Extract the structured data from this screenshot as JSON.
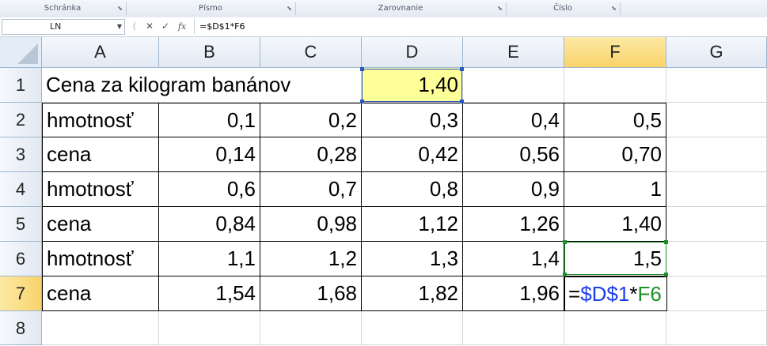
{
  "ribbon": {
    "groups": [
      {
        "label": "Schránka"
      },
      {
        "label": "Písmo"
      },
      {
        "label": "Zarovnanie"
      },
      {
        "label": "Číslo"
      }
    ]
  },
  "formula_bar": {
    "name_box": "LN",
    "cancel_glyph": "✕",
    "enter_glyph": "✓",
    "fx_label": "fx",
    "formula": "=$D$1*F6"
  },
  "columns": [
    "A",
    "B",
    "C",
    "D",
    "E",
    "F",
    "G"
  ],
  "rows": [
    "1",
    "2",
    "3",
    "4",
    "5",
    "6",
    "7",
    "8"
  ],
  "active_column": "F",
  "active_row": "7",
  "cells": {
    "A1": "Cena za kilogram banánov",
    "D1": "1,40",
    "A2": "hmotnosť",
    "B2": "0,1",
    "C2": "0,2",
    "D2": "0,3",
    "E2": "0,4",
    "F2": "0,5",
    "A3": "cena",
    "B3": "0,14",
    "C3": "0,28",
    "D3": "0,42",
    "E3": "0,56",
    "F3": "0,70",
    "A4": "hmotnosť",
    "B4": "0,6",
    "C4": "0,7",
    "D4": "0,8",
    "E4": "0,9",
    "F4": "1",
    "A5": "cena",
    "B5": "0,84",
    "C5": "0,98",
    "D5": "1,12",
    "E5": "1,26",
    "F5": "1,40",
    "A6": "hmotnosť",
    "B6": "1,1",
    "C6": "1,2",
    "D6": "1,3",
    "E6": "1,4",
    "F6": "1,5",
    "A7": "cena",
    "B7": "1,54",
    "C7": "1,68",
    "D7": "1,82",
    "E7": "1,96"
  },
  "edit_cell": {
    "address": "F7",
    "parts": {
      "eq": "=",
      "ref1": "$D$1",
      "op": "*",
      "ref2": "F6"
    }
  },
  "colors": {
    "highlight_fill": "#ffff99",
    "ref1_color": "#1a3df0",
    "ref2_color": "#1e8f2a"
  }
}
